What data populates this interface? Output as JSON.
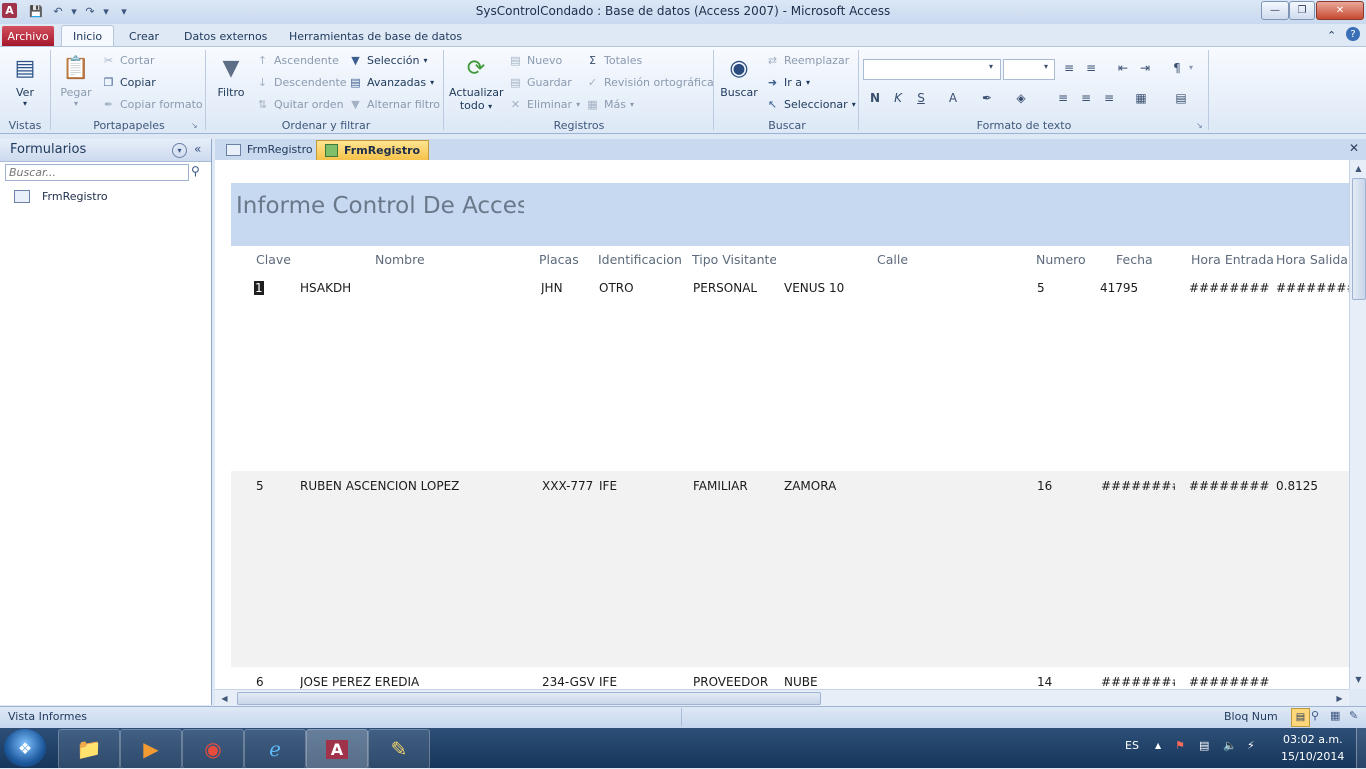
{
  "window": {
    "title": "SysControlCondado : Base de datos (Access 2007)  -  Microsoft Access",
    "app_icon_letter": "A"
  },
  "ribbon_tabs": [
    "Archivo",
    "Inicio",
    "Crear",
    "Datos externos",
    "Herramientas de base de datos"
  ],
  "groups": {
    "vistas": {
      "label": "Vistas",
      "ver": "Ver"
    },
    "portapapeles": {
      "label": "Portapapeles",
      "pegar": "Pegar",
      "cortar": "Cortar",
      "copiar": "Copiar",
      "copiar_formato": "Copiar formato"
    },
    "ordenar": {
      "label": "Ordenar y filtrar",
      "filtro": "Filtro",
      "ascendente": "Ascendente",
      "descendente": "Descendente",
      "quitar_orden": "Quitar orden",
      "seleccion": "Selección",
      "avanzadas": "Avanzadas",
      "alternar_filtro": "Alternar filtro"
    },
    "registros": {
      "label": "Registros",
      "actualizar_1": "Actualizar",
      "actualizar_2": "todo",
      "nuevo": "Nuevo",
      "guardar": "Guardar",
      "eliminar": "Eliminar",
      "totales": "Totales",
      "revision": "Revisión ortográfica",
      "mas": "Más"
    },
    "buscar": {
      "label": "Buscar",
      "buscar": "Buscar",
      "reemplazar": "Reemplazar",
      "ir_a": "Ir a",
      "seleccionar": "Seleccionar"
    },
    "formato": {
      "label": "Formato de texto",
      "bold": "N",
      "italic": "K",
      "underline": "S"
    }
  },
  "nav": {
    "title": "Formularios",
    "search_placeholder": "Buscar...",
    "item": "FrmRegistro"
  },
  "doc_tabs": [
    "FrmRegistro",
    "FrmRegistro"
  ],
  "report": {
    "title": "Informe Control De Acceso",
    "columns": [
      "Clave",
      "Nombre",
      "Placas",
      "Identificacion",
      "Tipo Visitante",
      "Calle",
      "Numero",
      "Fecha",
      "Hora Entrada",
      "Hora Salida"
    ],
    "rows": [
      {
        "clave": "1",
        "nombre": "HSAKDH",
        "placas": "JHN",
        "identificacion": "OTRO",
        "tipo": "PERSONAL",
        "calle": "VENUS 10",
        "numero": "5",
        "fecha": "41795",
        "hora_entrada": "############",
        "hora_salida": "############"
      },
      {
        "clave": "5",
        "nombre": "RUBEN ASCENCION LOPEZ",
        "placas": "XXX-777",
        "identificacion": "IFE",
        "tipo": "FAMILIAR",
        "calle": "ZAMORA",
        "numero": "16",
        "fecha": "###########",
        "hora_entrada": "############",
        "hora_salida": "0.8125"
      },
      {
        "clave": "6",
        "nombre": "JOSE PEREZ EREDIA",
        "placas": "234-GSV",
        "identificacion": "IFE",
        "tipo": "PROVEEDOR",
        "calle": "NUBE",
        "numero": "14",
        "fecha": "###########",
        "hora_entrada": "############",
        "hora_salida": ""
      }
    ]
  },
  "status": {
    "left": "Vista Informes",
    "right": "Bloq Num"
  },
  "tray": {
    "lang": "ES",
    "time": "03:02 a.m.",
    "date": "15/10/2014"
  }
}
